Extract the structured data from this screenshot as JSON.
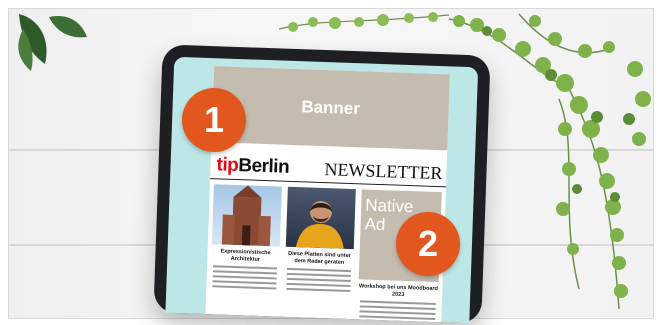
{
  "banner_label": "Banner",
  "masthead": {
    "logo_tip": "tip",
    "logo_rest": "Berlin",
    "title": "NEWSLETTER"
  },
  "articles": [
    {
      "headline": "Expressionistische Architektur"
    },
    {
      "headline": "Diese Platten sind unter dem Radar geraten"
    }
  ],
  "native_ad": {
    "label_line1": "Native",
    "label_line2": "Ad",
    "headline": "Workshop bei uns Moodboard 2023"
  },
  "badges": [
    "1",
    "2"
  ],
  "colors": {
    "badge": "#e2571e",
    "banner": "#c5bcb0",
    "screen": "#bde7e6",
    "logo_accent": "#e30613"
  }
}
